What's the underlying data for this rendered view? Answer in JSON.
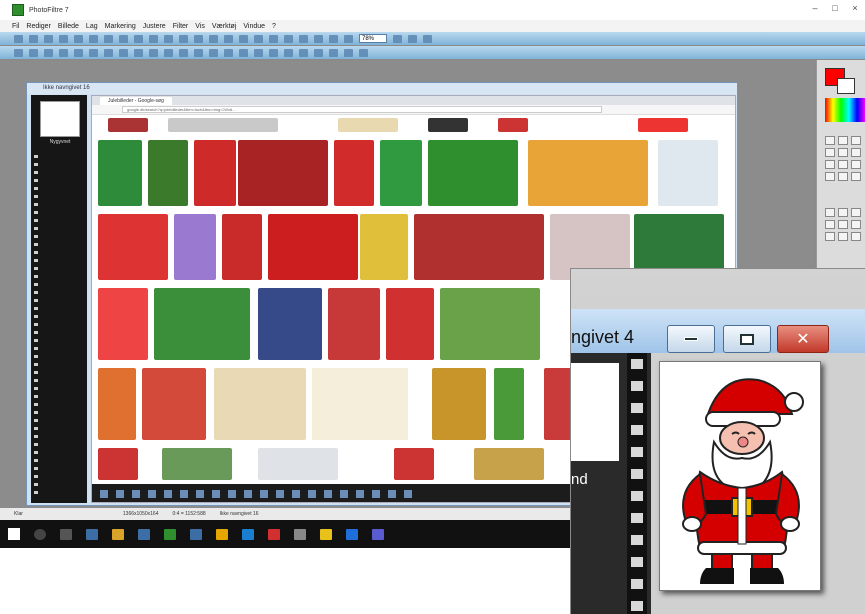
{
  "app": {
    "title": "PhotoFiltre 7",
    "menu": [
      "Fil",
      "Rediger",
      "Billede",
      "Lag",
      "Markering",
      "Justere",
      "Filter",
      "Vis",
      "Værktøj",
      "Vindue",
      "?"
    ],
    "zoom": "78%",
    "status": [
      "Klar",
      "1366x1050x164",
      "0:4 = 1152:588",
      "Ikke navngivet 16"
    ]
  },
  "document": {
    "title": "Ikke navngivet 16",
    "thumb_label": "Nygyvnet"
  },
  "browser": {
    "tab_label": "Julebilleder - Google-søg",
    "url": "google.dk/search?q=julebilleder&tbm=isch&tbs=rimg:CWx6..."
  },
  "zoom_window": {
    "title": "ngivet 4",
    "left_label": "nd"
  },
  "colors": {
    "foreground": "#ff0000",
    "background": "#ffffff",
    "toolbar": "#7fb3d8",
    "close_button": "#c2392a"
  },
  "icons": [
    "app-icon",
    "minimize-icon",
    "maximize-icon",
    "close-icon",
    "windows-start-icon",
    "search-icon",
    "taskview-icon"
  ]
}
